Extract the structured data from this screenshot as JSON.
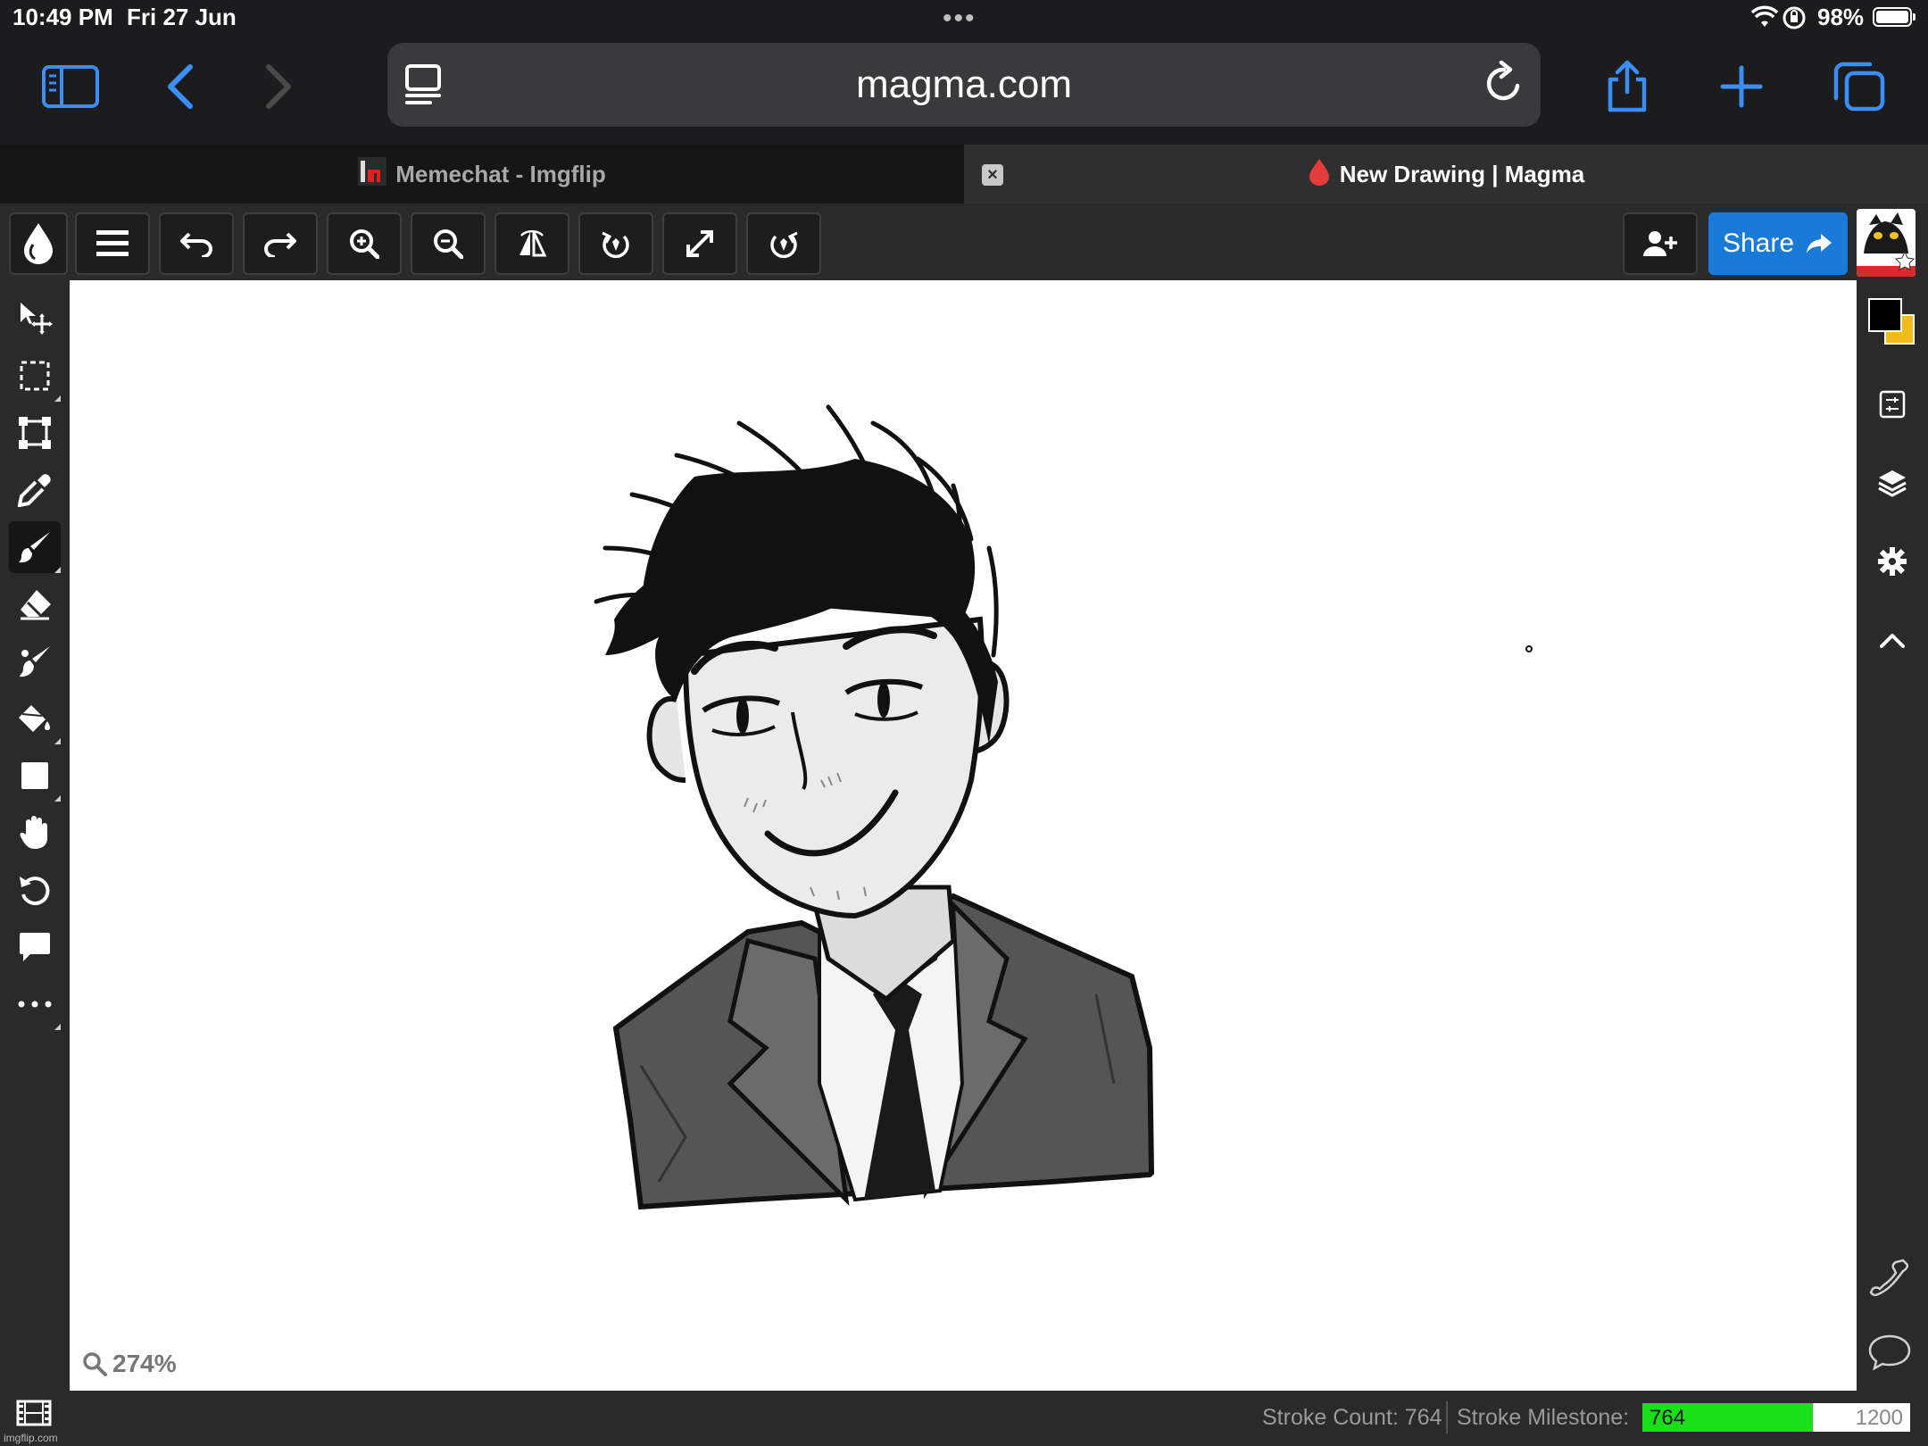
{
  "status_bar": {
    "time": "10:49 PM",
    "date": "Fri 27 Jun",
    "battery": "98%"
  },
  "browser": {
    "url": "magma.com",
    "tabs": [
      {
        "title": "Memechat - Imgflip",
        "active": false
      },
      {
        "title": "New Drawing | Magma",
        "active": true
      }
    ]
  },
  "toolbar": {
    "share_label": "Share",
    "buttons": [
      "magma-logo",
      "menu",
      "undo",
      "redo",
      "zoom-in",
      "zoom-out",
      "flip",
      "rotate-left",
      "fullscreen",
      "rotate-right"
    ]
  },
  "left_tools": [
    "move",
    "selection",
    "transform",
    "eyedropper",
    "brush",
    "eraser",
    "smudge",
    "fill",
    "shape",
    "hand",
    "rotate",
    "comment",
    "more"
  ],
  "active_tool": "brush",
  "canvas": {
    "zoom": "274%"
  },
  "colors": {
    "primary": "#000000",
    "secondary": "#f2bb1a"
  },
  "stats": {
    "stroke_count": "Stroke Count: 764",
    "milestone_label": "Stroke Milestone:",
    "milestone_current": "764",
    "milestone_target": "1200",
    "milestone_fraction": 0.6367
  },
  "watermark": "imgflip.com"
}
